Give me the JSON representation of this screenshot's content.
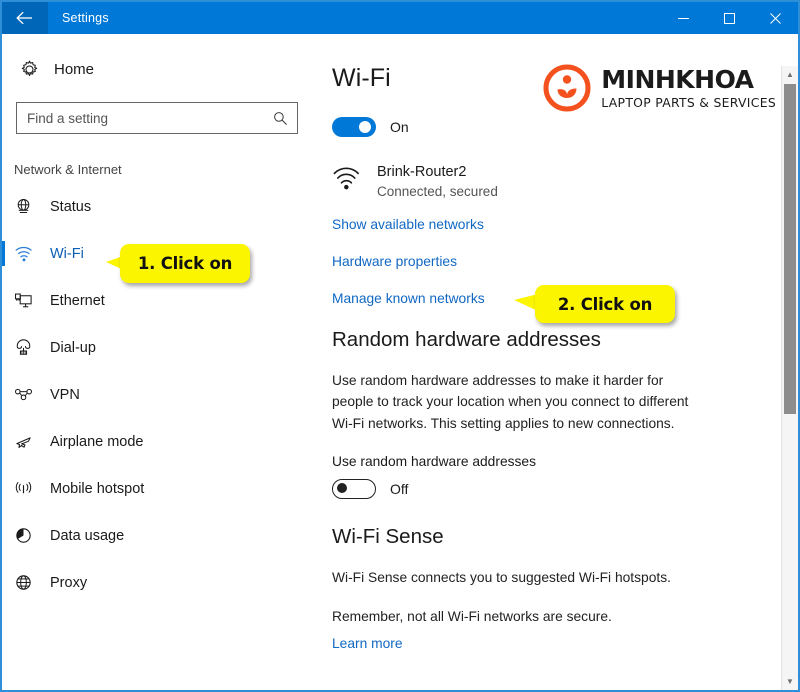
{
  "window": {
    "title": "Settings",
    "back_icon": "back-arrow-icon",
    "minimize_label": "─",
    "maximize_label": "□",
    "close_label": "✕",
    "accent_color": "#0078d7",
    "border_color": "#2e8fd8"
  },
  "sidebar": {
    "home_label": "Home",
    "home_icon": "gear-icon",
    "search": {
      "placeholder": "Find a setting",
      "value": "",
      "icon": "search-icon"
    },
    "category": "Network & Internet",
    "items": [
      {
        "label": "Status",
        "icon": "globe-network-icon",
        "selected": false
      },
      {
        "label": "Wi-Fi",
        "icon": "wifi-icon",
        "selected": true
      },
      {
        "label": "Ethernet",
        "icon": "ethernet-icon",
        "selected": false
      },
      {
        "label": "Dial-up",
        "icon": "dialup-phone-icon",
        "selected": false
      },
      {
        "label": "VPN",
        "icon": "vpn-icon",
        "selected": false
      },
      {
        "label": "Airplane mode",
        "icon": "airplane-icon",
        "selected": false
      },
      {
        "label": "Mobile hotspot",
        "icon": "hotspot-icon",
        "selected": false
      },
      {
        "label": "Data usage",
        "icon": "pie-chart-icon",
        "selected": false
      },
      {
        "label": "Proxy",
        "icon": "globe-icon",
        "selected": false
      }
    ]
  },
  "main": {
    "page_title": "Wi-Fi",
    "wifi_toggle": {
      "state": "on",
      "label": "On"
    },
    "network": {
      "icon": "wifi-connected-icon",
      "name": "Brink-Router2",
      "status": "Connected, secured"
    },
    "links": {
      "show_available_networks": "Show available networks",
      "hardware_properties": "Hardware properties",
      "manage_known_networks": "Manage known networks",
      "learn_more": "Learn more"
    },
    "random_hardware": {
      "heading": "Random hardware addresses",
      "description": "Use random hardware addresses to make it harder for people to track your location when you connect to different Wi-Fi networks. This setting applies to new connections.",
      "sub_label": "Use random hardware addresses",
      "toggle_state": "off",
      "toggle_label": "Off"
    },
    "wifi_sense": {
      "heading": "Wi-Fi Sense",
      "description": "Wi-Fi Sense connects you to suggested Wi-Fi hotspots.",
      "note": "Remember, not all Wi-Fi networks are secure."
    }
  },
  "callouts": [
    {
      "text": "1. Click on",
      "color": "#fbf500"
    },
    {
      "text": "2. Click on",
      "color": "#fbf500"
    }
  ],
  "watermark": {
    "title": "MINHKHOA",
    "subtitle": "LAPTOP PARTS & SERVICES",
    "logo_icon": "minh-khoa-logo-icon",
    "logo_color": "#f4511e"
  },
  "scrollbar": {
    "up_arrow": "▲",
    "down_arrow": "▼"
  }
}
